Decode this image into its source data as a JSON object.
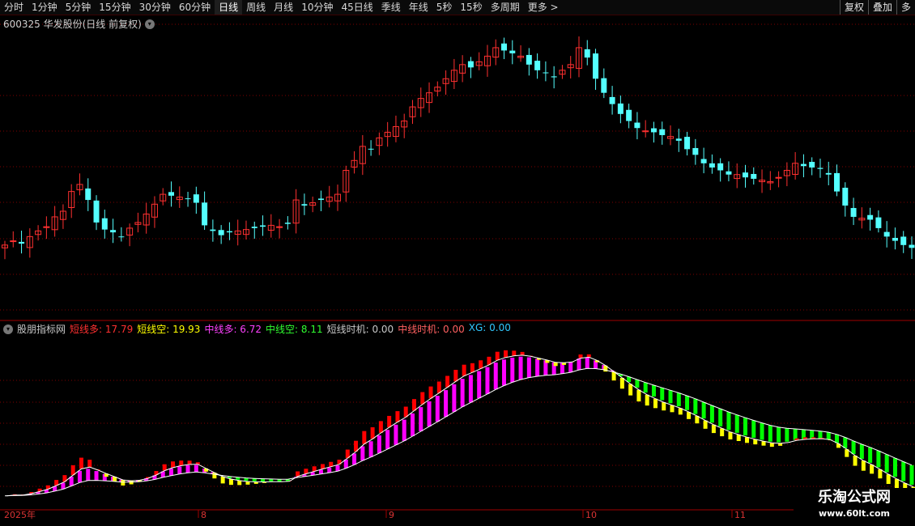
{
  "toolbar": {
    "periods": [
      "分时",
      "1分钟",
      "5分钟",
      "15分钟",
      "30分钟",
      "60分钟",
      "日线",
      "周线",
      "月线",
      "10分钟",
      "45日线",
      "季线",
      "年线",
      "5秒",
      "15秒",
      "多周期",
      "更多 >"
    ],
    "active_period": "日线",
    "right_buttons": [
      "复权",
      "叠加",
      "多"
    ]
  },
  "stock": {
    "title": "600325 华发股份(日线 前复权)"
  },
  "indicator": {
    "name": "股朋指标网",
    "values": [
      {
        "label": "短线多:",
        "value": "17.79",
        "color": "#ff3030"
      },
      {
        "label": "短线空:",
        "value": "19.93",
        "color": "#ffff00"
      },
      {
        "label": "中线多:",
        "value": "6.72",
        "color": "#ff40ff"
      },
      {
        "label": "中线空:",
        "value": "8.11",
        "color": "#30ff30"
      },
      {
        "label": "短线时机:",
        "value": "0.00",
        "color": "#c8c8c8"
      },
      {
        "label": "中线时机:",
        "value": "0.00",
        "color": "#ff6060"
      },
      {
        "label": "XG:",
        "value": "0.00",
        "color": "#30c8ff"
      }
    ]
  },
  "date_axis": [
    "2025年",
    "8",
    "9",
    "10",
    "11"
  ],
  "watermark": {
    "name": "乐淘公式网",
    "url": "www.60lt.com"
  },
  "colors": {
    "up": "#ff3030",
    "down": "#54ffff",
    "grid": "#800000",
    "bull_short": "#ff0000",
    "bear_short": "#ffff00",
    "bull_mid": "#ff00ff",
    "bear_mid": "#00ff00"
  },
  "chart_data": {
    "type": "candlestick",
    "close_series_approx": [
      4.02,
      4.05,
      4.03,
      4.08,
      4.12,
      4.15,
      4.22,
      4.26,
      4.4,
      4.45,
      4.34,
      4.18,
      4.13,
      4.11,
      4.08,
      4.14,
      4.18,
      4.24,
      4.31,
      4.38,
      4.37,
      4.36,
      4.35,
      4.32,
      4.16,
      4.12,
      4.09,
      4.11,
      4.12,
      4.13,
      4.14,
      4.15,
      4.16,
      4.15,
      4.17,
      4.34,
      4.3,
      4.32,
      4.34,
      4.36,
      4.38,
      4.55,
      4.62,
      4.72,
      4.7,
      4.78,
      4.82,
      4.86,
      4.9,
      5.0,
      5.06,
      5.1,
      5.14,
      5.2,
      5.26,
      5.3,
      5.28,
      5.32,
      5.36,
      5.42,
      5.4,
      5.38,
      5.36,
      5.3,
      5.26,
      5.24,
      5.21,
      5.26,
      5.3,
      5.42,
      5.35,
      5.2,
      5.1,
      5.02,
      4.95,
      4.9,
      4.85,
      4.83,
      4.82,
      4.8,
      4.79,
      4.76,
      4.7,
      4.66,
      4.6,
      4.57,
      4.55,
      4.52,
      4.52,
      4.5,
      4.49,
      4.48,
      4.47,
      4.5,
      4.55,
      4.6,
      4.58,
      4.57,
      4.56,
      4.52,
      4.4,
      4.3,
      4.22,
      4.21,
      4.2,
      4.14,
      4.08,
      4.05,
      4.02,
      4.0
    ]
  }
}
